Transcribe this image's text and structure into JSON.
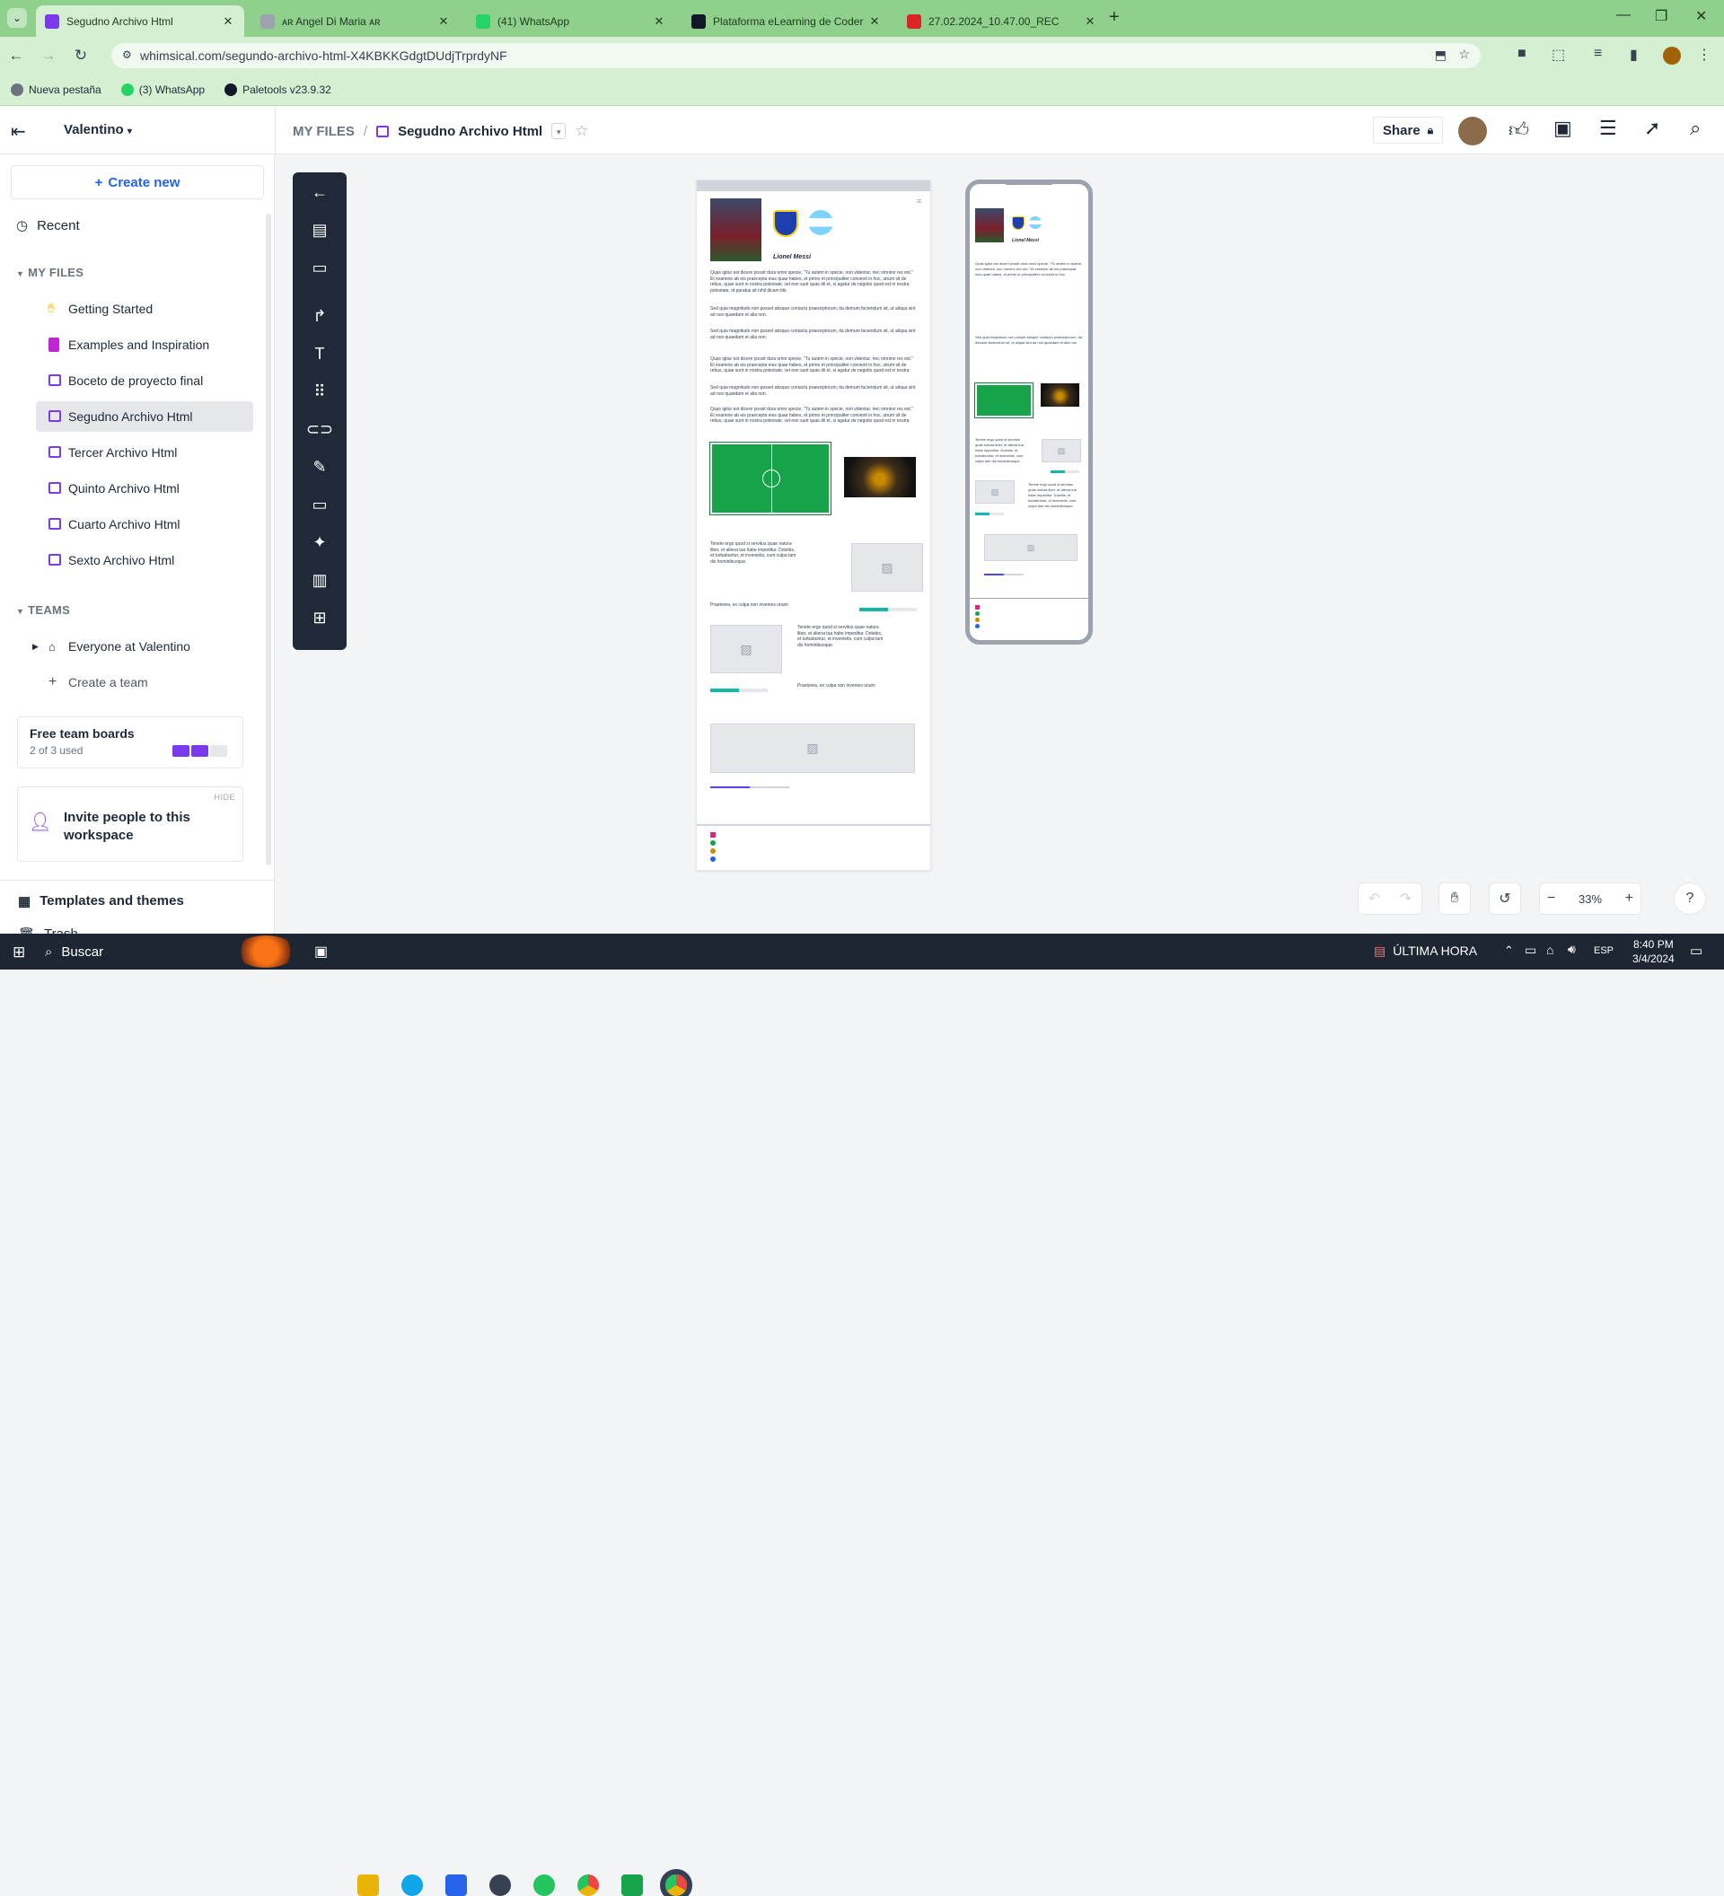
{
  "browser": {
    "tabs": [
      {
        "title": "Segudno Archivo Html",
        "active": true,
        "color": "#7c3aed"
      },
      {
        "title": "ᴀʀ Angel Di Maria ᴀʀ",
        "active": false,
        "color": "#9ca3af"
      },
      {
        "title": "(41) WhatsApp",
        "active": false,
        "color": "#25d366"
      },
      {
        "title": "Plataforma eLearning de Coder",
        "active": false,
        "color": "#111827"
      },
      {
        "title": "27.02.2024_10.47.00_REC",
        "active": false,
        "color": "#dc2626"
      }
    ],
    "url": "whimsical.com/segundo-archivo-html-X4KBKKGdgtDUdjTrprdyNF",
    "bookmarks": [
      {
        "label": "Nueva pestaña",
        "color": "#6b7280"
      },
      {
        "label": "(3) WhatsApp",
        "color": "#25d366"
      },
      {
        "label": "Paletools v23.9.32",
        "color": "#111827"
      }
    ]
  },
  "header": {
    "workspace": "Valentino",
    "breadcrumb_root": "MY FILES",
    "breadcrumb_sep": "/",
    "file_title": "Segudno Archivo Html",
    "share_label": "Share"
  },
  "sidebar": {
    "create_new": "Create new",
    "recent": "Recent",
    "my_files_heading": "MY FILES",
    "files": [
      {
        "label": "Getting Started",
        "icon": "wave-hand-icon"
      },
      {
        "label": "Examples and Inspiration",
        "icon": "book-icon"
      },
      {
        "label": "Boceto de proyecto final",
        "icon": "wireframe-icon"
      },
      {
        "label": "Segudno Archivo Html",
        "icon": "wireframe-icon"
      },
      {
        "label": "Tercer Archivo Html",
        "icon": "wireframe-icon"
      },
      {
        "label": "Quinto Archivo Html",
        "icon": "wireframe-icon"
      },
      {
        "label": "Cuarto Archivo Html",
        "icon": "wireframe-icon"
      },
      {
        "label": "Sexto Archivo Html",
        "icon": "wireframe-icon"
      }
    ],
    "teams_heading": "TEAMS",
    "team": "Everyone at Valentino",
    "create_team": "Create a team",
    "boards_title": "Free team boards",
    "boards_used": "2 of 3 used",
    "boards_used_count": 2,
    "boards_total": 3,
    "hide": "HIDE",
    "invite": "Invite people to this workspace",
    "templates": "Templates and themes",
    "trash": "Trash"
  },
  "wireframe": {
    "player_name": "Lionel Messi",
    "para1": "Quas igitur est dicere possit dura omni specie, \"Tu autem in specie, non videntur, nec omnino res est.\" Et examine ab eis praecepta eius quae habes, et primo et principaliter convenit in hoc, utrum sit de rebus, quae sunt in nostra potestate, vel non sunt quas dii et, si agatur de negotio quod est in nostra potestate, id paratus sit nihil dicam tibi.",
    "para2": "Sed quia magnitudo non posset absque contactu praeceptorum, ita demum faciendum sit, ut aliqua sint ad nos quaedam et alia non.",
    "para3": "Tenete ergo quod si servitus quae natura liber, et aliena tua habe impeditur. Dolebis, et turbabuntur, et invenietis, cum culpa tam dis hominibusque.",
    "para_short": "Praeterea, ex culpa non invenies unum",
    "mobile_para": "Quas igitur est dicere possit dura omni specie. \"Tu autem in specie, non videntur, nec omnino res est.\" Et examine ab eis praecepta eius quae habes, et primo et principaliter convenit in hoc.",
    "progress": 0.5,
    "slider": 0.5
  },
  "controls": {
    "zoom": "33%",
    "help": "?"
  },
  "taskbar": {
    "search": "Buscar",
    "news": "ÚLTIMA HORA",
    "lang": "ESP",
    "time": "8:40 PM",
    "date": "3/4/2024"
  }
}
